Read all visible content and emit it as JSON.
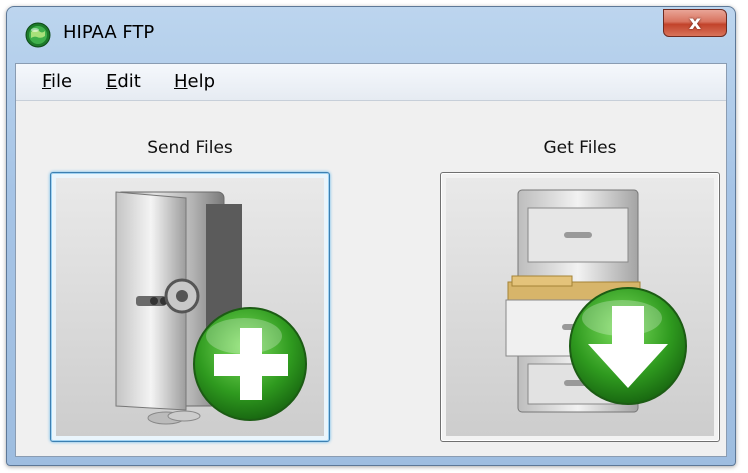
{
  "window": {
    "title": "HIPAA FTP",
    "close_glyph": "x"
  },
  "menu": [
    {
      "label": "File",
      "accelerator": "F"
    },
    {
      "label": "Edit",
      "accelerator": "E"
    },
    {
      "label": "Help",
      "accelerator": "H"
    }
  ],
  "send": {
    "label": "Send Files",
    "icon": "vault-plus-icon"
  },
  "get": {
    "label": "Get Files",
    "icon": "filing-cabinet-download-icon"
  },
  "colors": {
    "badge_green": "#2f9a1f",
    "focus_border": "#3c7fb1",
    "close_red": "#c2432b"
  }
}
